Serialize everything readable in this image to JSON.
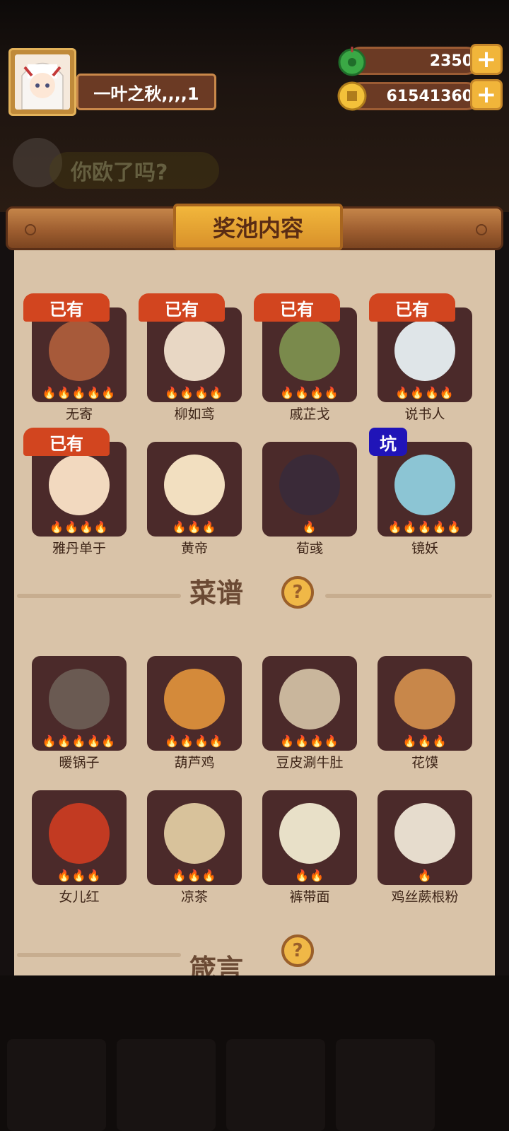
{
  "profile": {
    "name": "一叶之秋,,,,1"
  },
  "currencies": [
    {
      "icon": "jade-icon",
      "value": "2350"
    },
    {
      "icon": "coin-icon",
      "value": "61541360"
    }
  ],
  "background": {
    "banner_text": "你欧了吗?"
  },
  "panel": {
    "title": "奖池内容"
  },
  "characters": [
    {
      "name": "无寄",
      "badge": "已有",
      "stars": 5,
      "color": "#a75a3a"
    },
    {
      "name": "柳如鸢",
      "badge": "已有",
      "stars": 4,
      "color": "#e8d7c4"
    },
    {
      "name": "戚芷戈",
      "badge": "已有",
      "stars": 4,
      "color": "#7a8a4c"
    },
    {
      "name": "说书人",
      "badge": "已有",
      "stars": 4,
      "color": "#dfe5e8"
    },
    {
      "name": "雅丹单于",
      "badge": "已有",
      "stars": 4,
      "color": "#f2d9bf"
    },
    {
      "name": "黄帝",
      "badge": "",
      "stars": 3,
      "color": "#f2dfc0"
    },
    {
      "name": "荀彧",
      "badge": "",
      "stars": 1,
      "color": "#3a2a38"
    },
    {
      "name": "镜妖",
      "badge": "坑",
      "stars": 5,
      "color": "#8cc5d4"
    }
  ],
  "recipes_section": {
    "title": "菜谱",
    "help": "?"
  },
  "recipes": [
    {
      "name": "暖锅子",
      "stars": 5,
      "color": "#6a5a52"
    },
    {
      "name": "葫芦鸡",
      "stars": 4,
      "color": "#d48a3a"
    },
    {
      "name": "豆皮涮牛肚",
      "stars": 4,
      "color": "#c9b69c"
    },
    {
      "name": "花馍",
      "stars": 3,
      "color": "#c8874a"
    },
    {
      "name": "女儿红",
      "stars": 3,
      "color": "#c23a22"
    },
    {
      "name": "凉茶",
      "stars": 3,
      "color": "#d8c29b"
    },
    {
      "name": "裤带面",
      "stars": 2,
      "color": "#e8e0c8"
    },
    {
      "name": "鸡丝蕨根粉",
      "stars": 1,
      "color": "#e6dccd"
    }
  ],
  "next_section": {
    "title": "箴言",
    "help": "?"
  },
  "icons": {
    "flame": "🔥",
    "plus": "+"
  }
}
